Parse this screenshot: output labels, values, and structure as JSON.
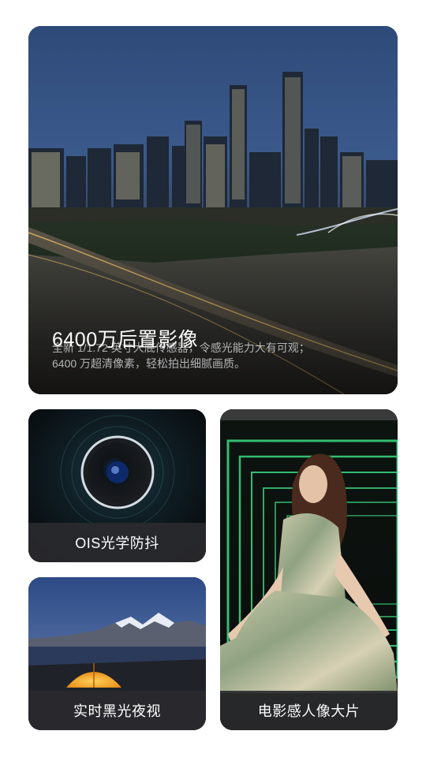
{
  "hero": {
    "title": "6400万后置影像",
    "desc_line1": "全新 1/1.72 英寸大底传感器，令感光能力大有可观；",
    "desc_line2": "6400 万超清像素，轻松拍出细腻画质。"
  },
  "features": {
    "ois_label": "OIS光学防抖",
    "night_label": "实时黑光夜视",
    "portrait_label": "电影感人像大片"
  },
  "colors": {
    "page_background": "#ffffff",
    "caption_bar": "#2a2a2e",
    "neon_green": "#3ddc84"
  }
}
